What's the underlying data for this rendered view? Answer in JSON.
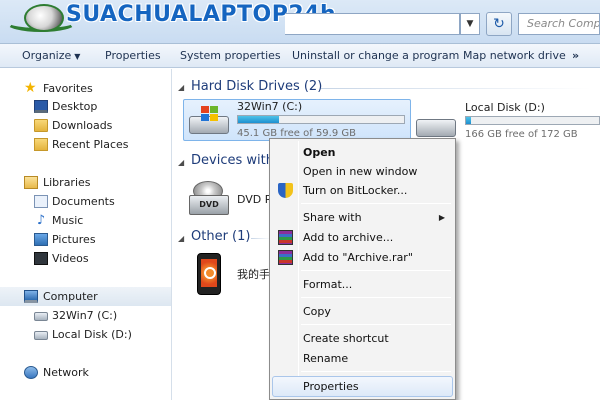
{
  "watermark": {
    "text": "SUACHUALAPTOP24h"
  },
  "search": {
    "placeholder": "Search Computer"
  },
  "toolbar": {
    "organize": "Organize",
    "properties": "Properties",
    "system_properties": "System properties",
    "uninstall": "Uninstall or change a program",
    "map_drive": "Map network drive",
    "more": "»"
  },
  "nav": {
    "favorites": "Favorites",
    "desktop": "Desktop",
    "downloads": "Downloads",
    "recent_places": "Recent Places",
    "libraries": "Libraries",
    "documents": "Documents",
    "music": "Music",
    "pictures": "Pictures",
    "videos": "Videos",
    "computer": "Computer",
    "drive_c": "32Win7  (C:)",
    "drive_d": "Local Disk (D:)",
    "network": "Network"
  },
  "content": {
    "hdd_group": "Hard Disk Drives (2)",
    "removable_group": "Devices with",
    "other_group": "Other (1)",
    "drive_c": {
      "name": "32Win7  (C:)",
      "free": "45.1 GB free of 59.9 GB",
      "used_fraction": 0.247
    },
    "drive_d": {
      "name": "Local Disk (D:)",
      "free": "166 GB free of 172 GB",
      "used_fraction": 0.035
    },
    "dvd": {
      "name": "DVD RW",
      "badge": "DVD"
    },
    "device": {
      "name": "我的手"
    }
  },
  "context_menu": {
    "open": "Open",
    "open_new_window": "Open in new window",
    "bitlocker": "Turn on BitLocker...",
    "share_with": "Share with",
    "add_to_archive": "Add to archive...",
    "add_to_rar": "Add to \"Archive.rar\"",
    "format": "Format...",
    "copy": "Copy",
    "create_shortcut": "Create shortcut",
    "rename": "Rename",
    "properties": "Properties"
  },
  "colors": {
    "accent": "#1e3c7a",
    "selection": "#cfe4fb",
    "bar_fill": "#1d8fd0",
    "watermark": "#1565c0"
  },
  "icons": {
    "favorites": "star-icon",
    "desktop": "desktop-icon",
    "downloads": "folder-icon",
    "recent": "recent-places-icon",
    "libraries": "libraries-icon",
    "documents": "document-icon",
    "music": "music-icon",
    "pictures": "pictures-icon",
    "videos": "videos-icon",
    "computer": "computer-icon",
    "drive": "drive-icon",
    "network": "network-icon",
    "shield": "uac-shield-icon",
    "archive": "winrar-icon"
  }
}
